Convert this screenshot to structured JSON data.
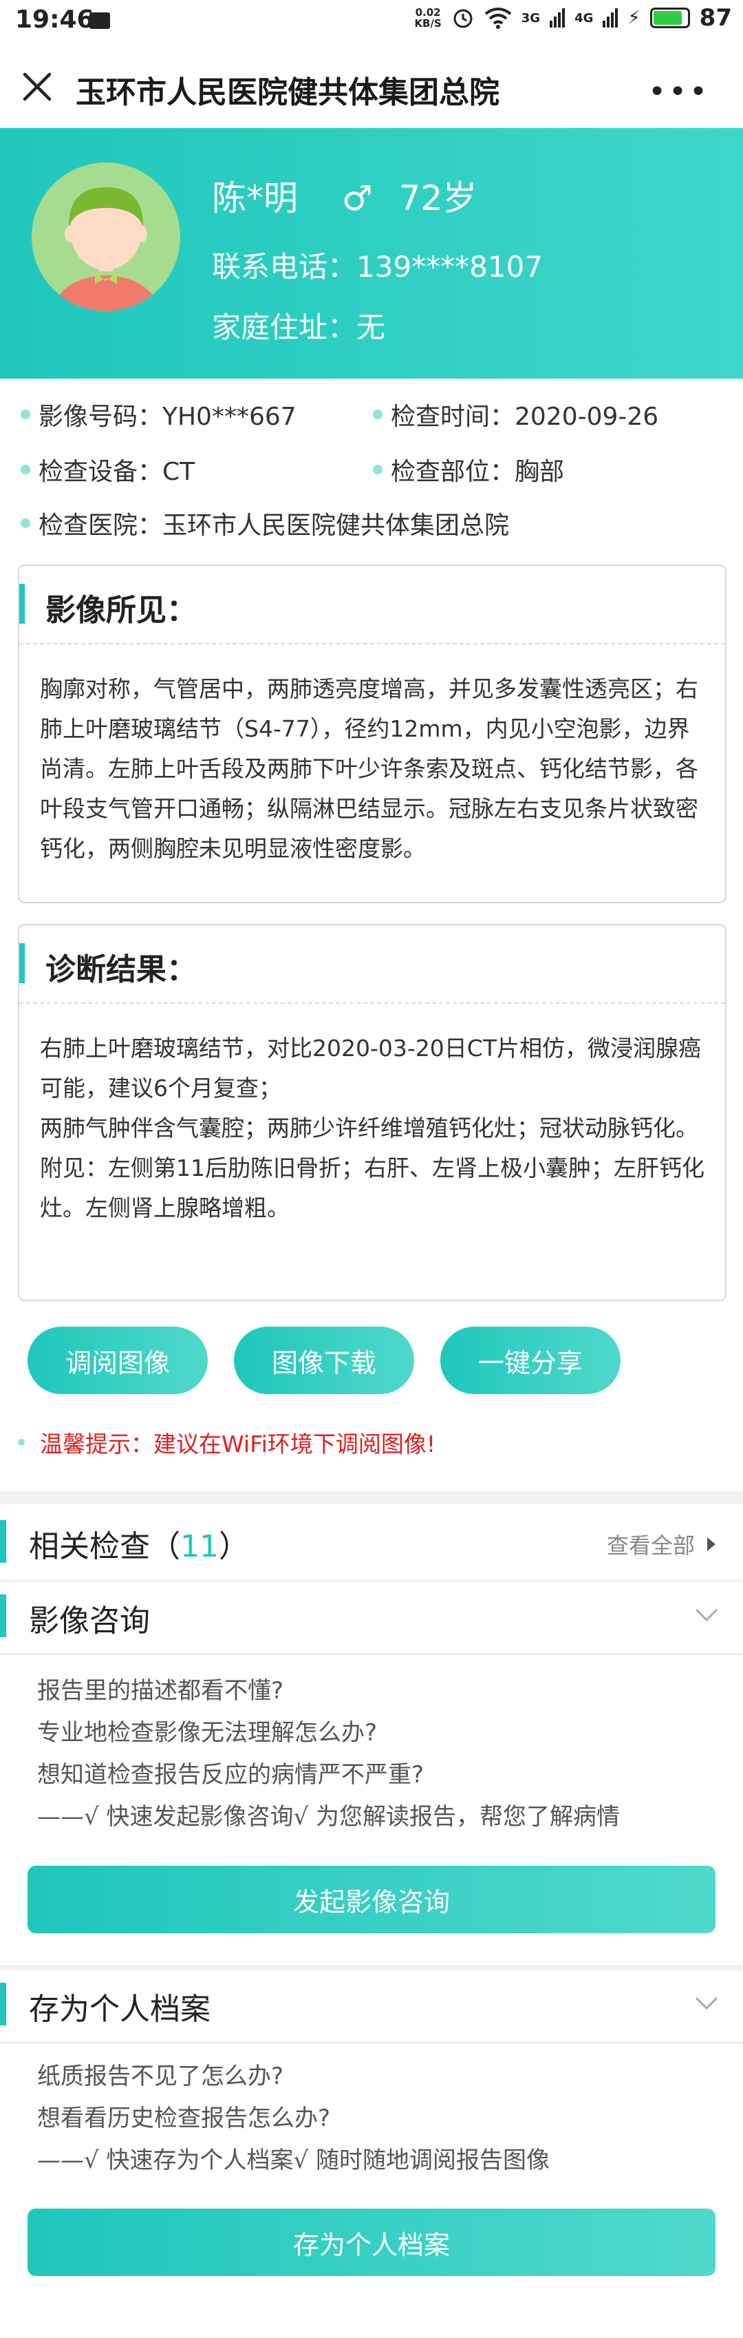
{
  "status_bar": {
    "time": "19:46",
    "net_speed_value": "0.02",
    "net_speed_unit": "KB/S",
    "signal1": "3G",
    "signal2": "4G",
    "battery": "87"
  },
  "titlebar": {
    "title": "玉环市人民医院健共体集团总院"
  },
  "patient": {
    "name": "陈*明",
    "gender_symbol": "♂",
    "age": "72岁",
    "phone": "联系电话：139****8107",
    "address": "家庭住址：无"
  },
  "info": {
    "image_no": "影像号码：YH0***667",
    "exam_time": "检查时间：2020-09-26",
    "device": "检查设备：CT",
    "body_part": "检查部位：胸部",
    "hospital": "检查医院：玉环市人民医院健共体集团总院"
  },
  "findings": {
    "title": "影像所见：",
    "text": "胸廓对称，气管居中，两肺透亮度增高，并见多发囊性透亮区；右肺上叶磨玻璃结节（S4-77），径约12mm，内见小空泡影，边界尚清。左肺上叶舌段及两肺下叶少许条索及斑点、钙化结节影，各叶段支气管开口通畅；纵隔淋巴结显示。冠脉左右支见条片状致密钙化，两侧胸腔未见明显液性密度影。"
  },
  "diagnosis": {
    "title": "诊断结果：",
    "line1": "右肺上叶磨玻璃结节，对比2020-03-20日CT片相仿，微浸润腺癌可能，建议6个月复查；",
    "line2": "两肺气肿伴含气囊腔；两肺少许纤维增殖钙化灶；冠状动脉钙化。",
    "line3": "附见：左侧第11后肋陈旧骨折；右肝、左肾上极小囊肿；左肝钙化灶。左侧肾上腺略增粗。"
  },
  "actions": {
    "view_image": "调阅图像",
    "download_image": "图像下载",
    "share": "一键分享"
  },
  "tip": "温馨提示：建议在WiFi环境下调阅图像!",
  "related": {
    "title": "相关检查（",
    "count": "11",
    "title_end": "）",
    "view_all": "查看全部"
  },
  "consult": {
    "title": "影像咨询",
    "lines": [
      "报告里的描述都看不懂?",
      "专业地检查影像无法理解怎么办?",
      "想知道检查报告反应的病情严不严重?",
      "——√ 快速发起影像咨询√ 为您解读报告，帮您了解病情"
    ],
    "button": "发起影像咨询"
  },
  "archive": {
    "title": "存为个人档案",
    "lines": [
      "纸质报告不见了怎么办?",
      "想看看历史检查报告怎么办?",
      "——√ 快速存为个人档案√ 随时随地调阅报告图像"
    ],
    "button": "存为个人档案"
  },
  "colors": {
    "accent": "#1fc7bc",
    "tip_red": "#e02020"
  }
}
